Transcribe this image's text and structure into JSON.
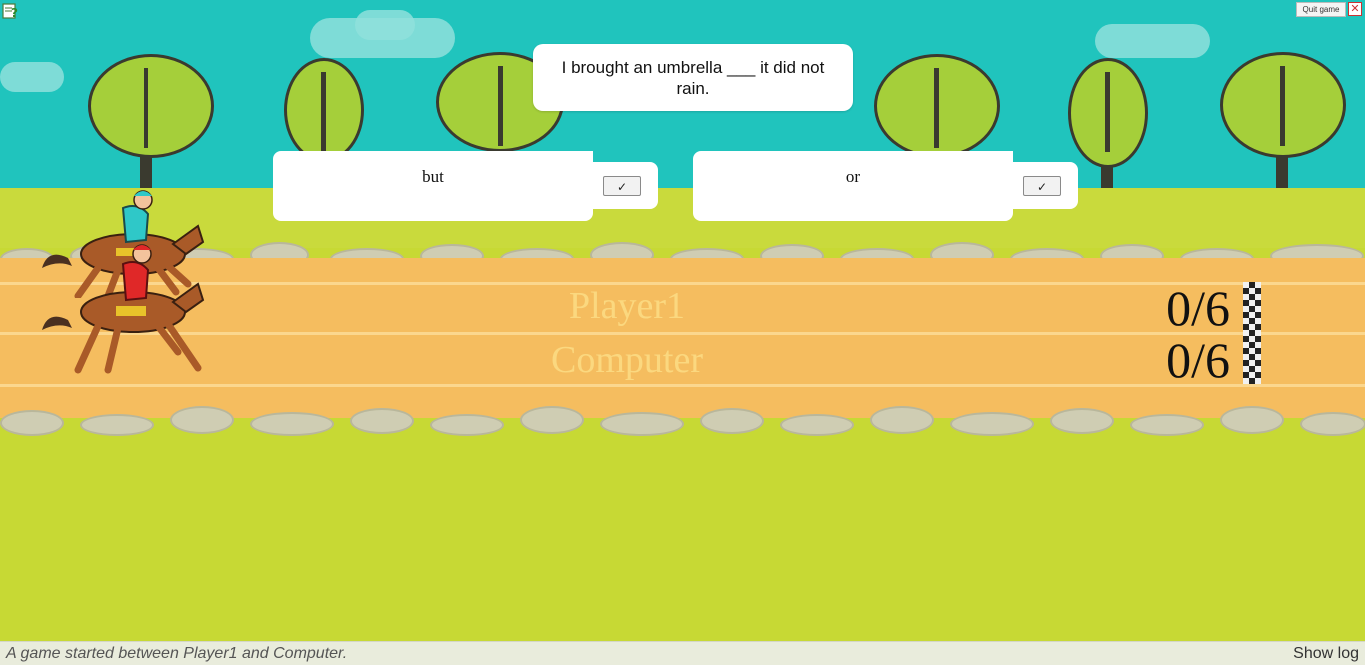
{
  "question": {
    "text": "I brought an umbrella ___ it did not rain."
  },
  "answers": [
    {
      "label": "but",
      "check": "✓"
    },
    {
      "label": "or",
      "check": "✓"
    }
  ],
  "players": [
    {
      "name": "Player1",
      "score": "0/6"
    },
    {
      "name": "Computer",
      "score": "0/6"
    }
  ],
  "toolbar": {
    "quit_label": "Quit game"
  },
  "status": {
    "message": "A game started between Player1 and Computer.",
    "show_log_label": "Show log"
  },
  "icons": {
    "help": "help-icon",
    "fullscreen": "fullscreen-icon",
    "horse_player": "horse-rider-teal-icon",
    "horse_computer": "horse-rider-red-icon",
    "finish": "finish-flag-icon"
  },
  "colors": {
    "sky": "#20c4bd",
    "track": "#f5bd5f",
    "grass": "#c7d934",
    "player_name": "#fbd87f"
  }
}
